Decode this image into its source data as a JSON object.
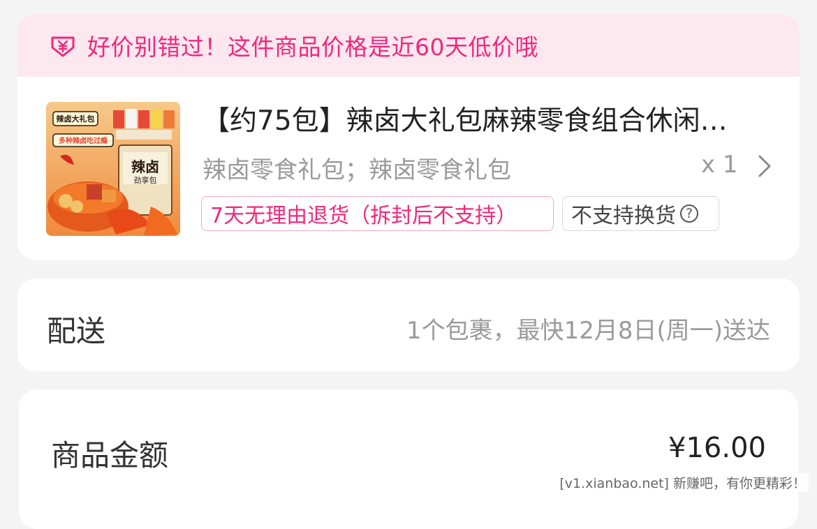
{
  "promo": {
    "text": "好价别错过！这件商品价格是近60天低价哦",
    "icon": "price-tag-yen-icon",
    "color": "#f0287c",
    "background": "#fde8f0"
  },
  "product": {
    "title": "【约75包】辣卤大礼包麻辣零食组合休闲…",
    "spec": "辣卤零食礼包；辣卤零食礼包",
    "quantity": "x 1",
    "image": {
      "badge_top": "辣卤大礼包",
      "badge_mid": "多种辣卤吃过瘾",
      "package_text": "辣卤",
      "package_sub": "劲享包"
    },
    "tags": {
      "return_policy": "7天无理由退货（拆封后不支持）",
      "exchange_policy": "不支持换货"
    }
  },
  "delivery": {
    "label": "配送",
    "info": "1个包裹，最快12月8日(周一)送达"
  },
  "amount": {
    "label": "商品金额",
    "value": "¥16.00"
  },
  "watermark": "[v1.xianbao.net] 新赚吧，有你更精彩！"
}
